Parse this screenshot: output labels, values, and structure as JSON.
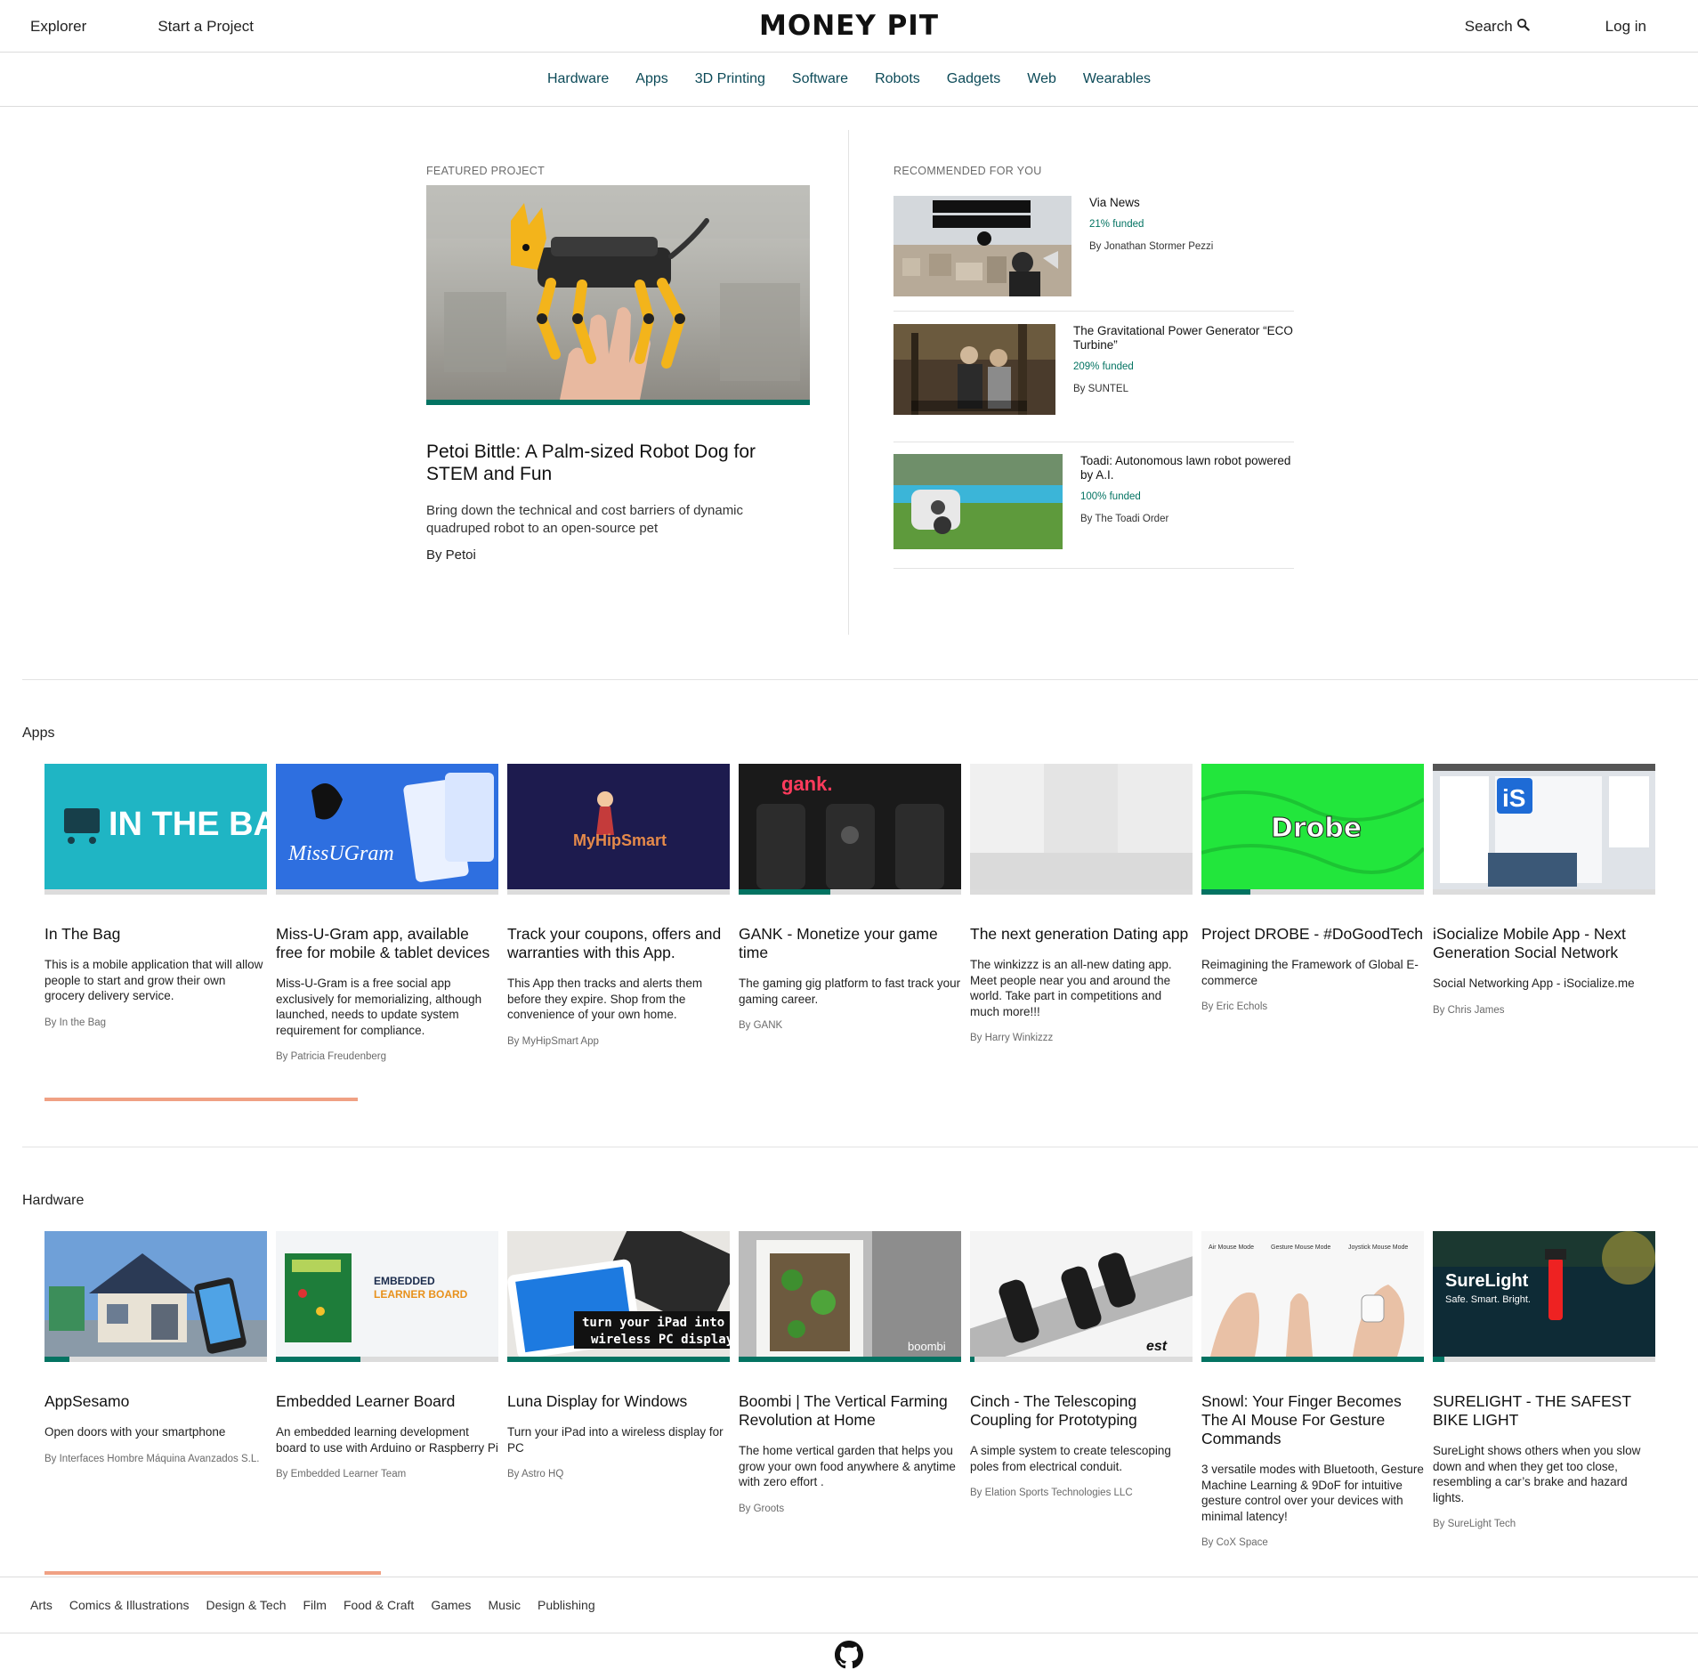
{
  "header": {
    "explorer_label": "Explorer",
    "start_project_label": "Start a Project",
    "logo_text": "MONEY PIT",
    "search_label": "Search",
    "login_label": "Log in"
  },
  "categories": [
    "Hardware",
    "Apps",
    "3D Printing",
    "Software",
    "Robots",
    "Gadgets",
    "Web",
    "Wearables"
  ],
  "featured": {
    "label": "FEATURED PROJECT",
    "title": "Petoi Bittle: A Palm-sized Robot Dog for STEM and Fun",
    "description": "Bring down the technical and cost barriers of dynamic quadruped robot to an open-source pet",
    "by": "By Petoi",
    "funded_fraction": 1.0
  },
  "recommended": {
    "label": "RECOMMENDED FOR YOU",
    "items": [
      {
        "title": "Via News",
        "funded": "21% funded",
        "by": "By Jonathan Stormer Pezzi"
      },
      {
        "title": "The Gravitational Power Generator “ECO Turbine”",
        "funded": "209% funded",
        "by": "By SUNTEL"
      },
      {
        "title": "Toadi: Autonomous lawn robot powered by A.I.",
        "funded": "100% funded",
        "by": "By The Toadi Order"
      }
    ]
  },
  "rows": [
    {
      "title": "Apps",
      "cards": [
        {
          "title": "In The Bag",
          "description": "This is a mobile application that will allow people to start and grow their own grocery delivery service.",
          "by": "By In the Bag",
          "funded": 0.0,
          "image_text": "IN THE BAG"
        },
        {
          "title": "Miss-U-Gram app, available free for mobile & tablet devices",
          "description": "Miss-U-Gram is a free social app exclusively for memorializing, although launched, needs to update system requirement for compliance.",
          "by": "By Patricia Freudenberg",
          "funded": 0.0,
          "image_text": "MissUGram"
        },
        {
          "title": "Track your coupons, offers and warranties with this App.",
          "description": "This App then tracks and alerts them before they expire. Shop from the convenience of your own home.",
          "by": "By MyHipSmart App",
          "funded": 0.0,
          "image_text": "MyHipSmart"
        },
        {
          "title": "GANK - Monetize your game time",
          "description": "The gaming gig platform to fast track your gaming career.",
          "by": "By GANK",
          "funded": 0.41,
          "image_text": "gank."
        },
        {
          "title": "The next generation Dating app",
          "description": "The winkizzz is an all-new dating app. Meet people near you and around the world. Take part in competitions and much more!!!",
          "by": "By Harry Winkizzz",
          "funded": 0.0,
          "image_text": ""
        },
        {
          "title": "Project DROBE - #DoGoodTech",
          "description": "Reimagining the Framework of Global E-commerce",
          "by": "By Eric Echols",
          "funded": 0.22,
          "image_text": "Drobe"
        },
        {
          "title": "iSocialize Mobile App - Next Generation Social Network",
          "description": "Social Networking App - iSocialize.me",
          "by": "By Chris James",
          "funded": 0.0,
          "image_text": "iS"
        }
      ]
    },
    {
      "title": "Hardware",
      "cards": [
        {
          "title": "AppSesamo",
          "description": "Open doors with your smartphone",
          "by": "By Interfaces Hombre Máquina Avanzados S.L.",
          "funded": 0.11,
          "image_text": ""
        },
        {
          "title": "Embedded Learner Board",
          "description": "An embedded learning development board to use with Arduino or Raspberry Pi",
          "by": "By Embedded Learner Team",
          "funded": 0.38,
          "image_text": "EMBEDDED LEARNER BOARD"
        },
        {
          "title": "Luna Display for Windows",
          "description": "Turn your iPad into a wireless display for PC",
          "by": "By Astro HQ",
          "funded": 1.0,
          "image_text": "turn your iPad into a wireless PC display"
        },
        {
          "title": "Boombi | The Vertical Farming Revolution at Home",
          "description": "The home vertical garden that helps you grow your own food anywhere & anytime with zero effort .",
          "by": "By Groots",
          "funded": 1.0,
          "image_text": "boombi"
        },
        {
          "title": "Cinch - The Telescoping Coupling for Prototyping",
          "description": "A simple system to create telescoping poles from electrical conduit.",
          "by": "By Elation Sports Technologies LLC",
          "funded": 0.02,
          "image_text": "est"
        },
        {
          "title": "Snowl: Your Finger Becomes The AI Mouse For Gesture Commands",
          "description": "3 versatile modes with Bluetooth, Gesture Machine Learning & 9DoF for intuitive gesture control over your devices with minimal latency!",
          "by": "By CoX Space",
          "funded": 1.0,
          "image_text": "Air Mouse Mode   Gesture Mouse Mode   Joystick Mouse Mode"
        },
        {
          "title": "SURELIGHT - THE SAFEST BIKE LIGHT",
          "description": "SureLight shows others when you slow down and when they get too close, resembling a car’s brake and hazard lights.",
          "by": "By SureLight Tech",
          "funded": 0.05,
          "image_text": "SureLight"
        }
      ]
    }
  ],
  "footer": {
    "links": [
      "Arts",
      "Comics & Illustrations",
      "Design & Tech",
      "Film",
      "Food & Craft",
      "Games",
      "Music",
      "Publishing"
    ]
  },
  "colors": {
    "brand_green": "#05ce78",
    "funded_dark": "#037362",
    "link": "#0c4a58",
    "scroll_accent": "#f0a184"
  }
}
